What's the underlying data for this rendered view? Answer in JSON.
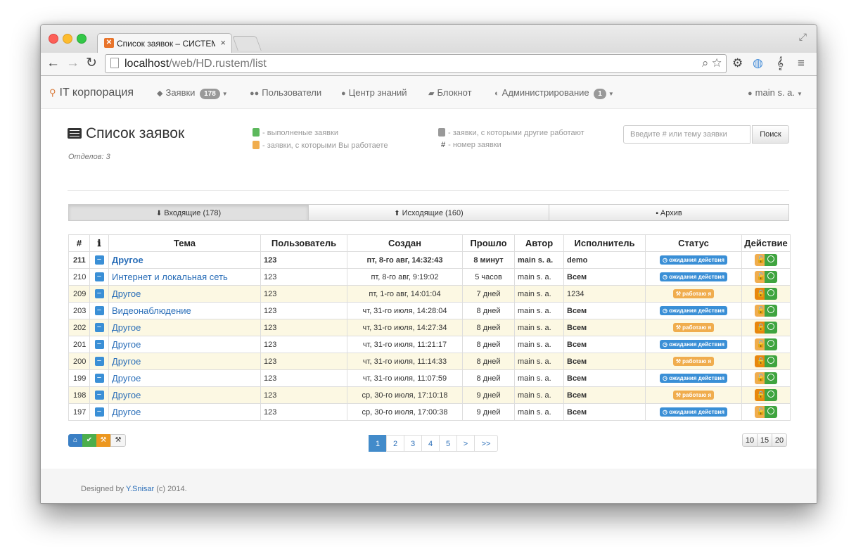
{
  "browser": {
    "tab_title": "Список заявок – СИСТЕМА",
    "url_host": "localhost",
    "url_path": "/web/HD.rustem/list"
  },
  "navbar": {
    "brand": "IT корпорация",
    "items": [
      {
        "label": "Заявки",
        "badge": "178",
        "icon": "tags-icon"
      },
      {
        "label": "Пользователи",
        "icon": "users-icon"
      },
      {
        "label": "Центр знаний",
        "icon": "globe-icon"
      },
      {
        "label": "Блокнот",
        "icon": "book-icon"
      },
      {
        "label": "Администрирование",
        "badge": "1",
        "icon": "shield-icon"
      }
    ],
    "user": "main s. a."
  },
  "header": {
    "title": "Список заявок",
    "departments": "Отделов: 3",
    "legend": [
      {
        "text": "- выполненые заявки",
        "color": "#5cb85c"
      },
      {
        "text": "- заявки, с которыми Вы работаете",
        "color": "#f0ad4e"
      },
      {
        "text": "- заявки, с которыми другие работают",
        "color": "#999999"
      },
      {
        "text": "#",
        "text2": "- номер заявки"
      }
    ],
    "search_placeholder": "Введите # или тему заявки",
    "search_button": "Поиск"
  },
  "tabs": [
    {
      "label": "Входящие (178)",
      "icon": "download-icon",
      "active": true
    },
    {
      "label": "Исходящие (160)",
      "icon": "upload-icon",
      "active": false
    },
    {
      "label": "Архив",
      "icon": "archive-icon",
      "active": false
    }
  ],
  "table": {
    "headers": [
      "#",
      "ℹ",
      "Тема",
      "Пользователь",
      "Создан",
      "Прошло",
      "Автор",
      "Исполнитель",
      "Статус",
      "Действие"
    ],
    "rows": [
      {
        "id": "211",
        "topic": "Другое",
        "user": "123",
        "created": "пт, 8-го авг, 14:32:43",
        "elapsed": "8 минут",
        "author": "main s. a.",
        "executor": "demo",
        "status": "ожидания действия",
        "status_type": "waiting",
        "highlight": false,
        "bold": true
      },
      {
        "id": "210",
        "topic": "Интернет и локальная сеть",
        "user": "123",
        "created": "пт, 8-го авг, 9:19:02",
        "elapsed": "5 часов",
        "author": "main s. a.",
        "executor": "Всем",
        "status": "ожидания действия",
        "status_type": "waiting",
        "highlight": false,
        "bold": false
      },
      {
        "id": "209",
        "topic": "Другое",
        "user": "123",
        "created": "пт, 1-го авг, 14:01:04",
        "elapsed": "7 дней",
        "author": "main s. a.",
        "executor": "1234",
        "status": "работаю я",
        "status_type": "working",
        "highlight": true,
        "bold": false
      },
      {
        "id": "203",
        "topic": "Видеонаблюдение",
        "user": "123",
        "created": "чт, 31-го июля, 14:28:04",
        "elapsed": "8 дней",
        "author": "main s. a.",
        "executor": "Всем",
        "status": "ожидания действия",
        "status_type": "waiting",
        "highlight": false,
        "bold": false
      },
      {
        "id": "202",
        "topic": "Другое",
        "user": "123",
        "created": "чт, 31-го июля, 14:27:34",
        "elapsed": "8 дней",
        "author": "main s. a.",
        "executor": "Всем",
        "status": "работаю я",
        "status_type": "working",
        "highlight": true,
        "bold": false
      },
      {
        "id": "201",
        "topic": "Другое",
        "user": "123",
        "created": "чт, 31-го июля, 11:21:17",
        "elapsed": "8 дней",
        "author": "main s. a.",
        "executor": "Всем",
        "status": "ожидания действия",
        "status_type": "waiting",
        "highlight": false,
        "bold": false
      },
      {
        "id": "200",
        "topic": "Другое",
        "user": "123",
        "created": "чт, 31-го июля, 11:14:33",
        "elapsed": "8 дней",
        "author": "main s. a.",
        "executor": "Всем",
        "status": "работаю я",
        "status_type": "working",
        "highlight": true,
        "bold": false
      },
      {
        "id": "199",
        "topic": "Другое",
        "user": "123",
        "created": "чт, 31-го июля, 11:07:59",
        "elapsed": "8 дней",
        "author": "main s. a.",
        "executor": "Всем",
        "status": "ожидания действия",
        "status_type": "waiting",
        "highlight": false,
        "bold": false
      },
      {
        "id": "198",
        "topic": "Другое",
        "user": "123",
        "created": "ср, 30-го июля, 17:10:18",
        "elapsed": "9 дней",
        "author": "main s. a.",
        "executor": "Всем",
        "status": "работаю я",
        "status_type": "working",
        "highlight": true,
        "bold": false
      },
      {
        "id": "197",
        "topic": "Другое",
        "user": "123",
        "created": "ср, 30-го июля, 17:00:38",
        "elapsed": "9 дней",
        "author": "main s. a.",
        "executor": "Всем",
        "status": "ожидания действия",
        "status_type": "waiting",
        "highlight": false,
        "bold": false
      }
    ]
  },
  "filters": [
    {
      "icon": "home-icon",
      "glyph": "⌂",
      "color": "#3a7fc4"
    },
    {
      "icon": "check-icon",
      "glyph": "✔",
      "color": "#4cae4c"
    },
    {
      "icon": "hammer-icon",
      "glyph": "⚒",
      "color": "#ec971f"
    },
    {
      "icon": "gavel-icon",
      "glyph": "⚒",
      "color": "#f5f5f5"
    }
  ],
  "pagination": [
    "1",
    "2",
    "3",
    "4",
    "5",
    ">",
    ">>"
  ],
  "pagination_active": "1",
  "per_page": [
    "10",
    "15",
    "20"
  ],
  "footer": {
    "prefix": "Designed by",
    "author": "Y.Snisar",
    "suffix": "(c) 2014."
  }
}
